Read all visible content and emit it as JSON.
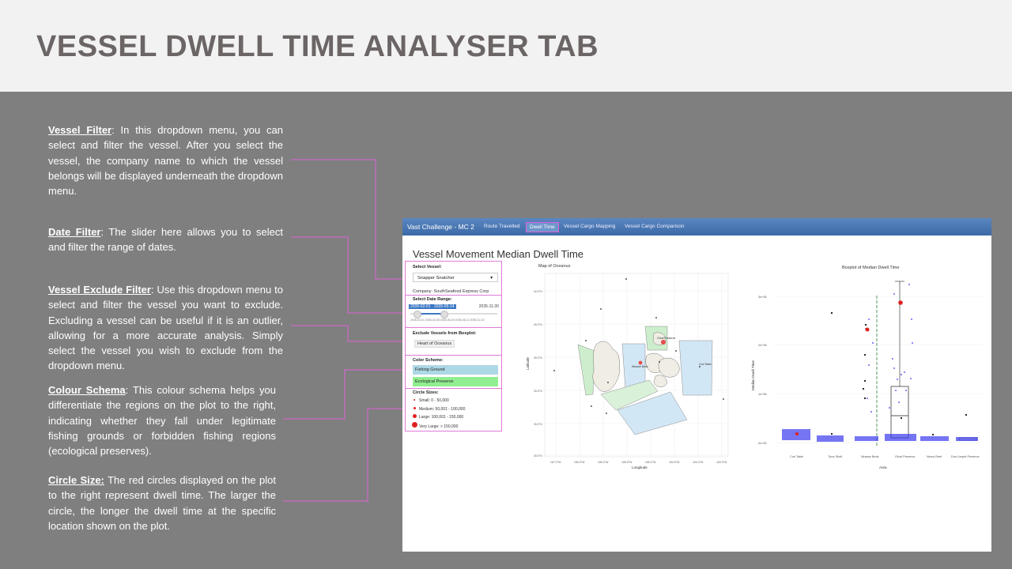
{
  "slide": {
    "title": "VESSEL DWELL TIME ANALYSER TAB"
  },
  "notes": [
    {
      "head": "Vessel Filter",
      "text": ": In this dropdown menu, you can select and filter the vessel. After you select the vessel, the company name to which the vessel belongs will be displayed underneath the dropdown menu."
    },
    {
      "head": "Date Filter",
      "text": ": The slider here allows you to select and filter the range of dates."
    },
    {
      "head": "Vessel Exclude Filter",
      "text": ": Use this dropdown menu to select and filter the vessel you want to exclude. Excluding a vessel can be useful if it is an outlier, allowing for a more accurate analysis. Simply select the vessel you wish to exclude from the dropdown menu."
    },
    {
      "head": "Colour Schema",
      "text": ": This colour schema helps you differentiate the regions on the plot to the right, indicating whether they fall under legitimate fishing grounds or forbidden fishing regions (ecological preserves)."
    },
    {
      "head": "Circle Size:",
      "text": " The red circles displayed on the plot to the right represent dwell time. The larger the circle, the longer the dwell time at the specific location shown on the plot."
    }
  ],
  "app": {
    "brand": "Vast Challenge - MC 2",
    "tabs": [
      "Route Travelled",
      "Dwell Time",
      "Vessel Cargo Mapping",
      "Vessel Cargo Comparison"
    ],
    "active_tab": "Dwell Time",
    "title": "Vessel Movement Median Dwell Time",
    "vessel": {
      "label": "Select Vessel:",
      "value": "Snapper Snatcher",
      "company": "Company: SouthSeafood Express Corp"
    },
    "date": {
      "label": "Select Date Range:",
      "start": "2035-02-01",
      "end": "2035-05-14",
      "max": "2035-11-30",
      "ticks": [
        "2035-02-01",
        "2035-04-08",
        "2035-06-09",
        "2035-08-12",
        "2035-10-15"
      ]
    },
    "exclude": {
      "label": "Exclude Vessels from Boxplot:",
      "value": "Heart of Oceanus"
    },
    "scheme": {
      "label": "Color Scheme:",
      "items": [
        "Fishing Ground",
        "Ecological Preserve"
      ],
      "colors": [
        "#add8e6",
        "#90ee90"
      ]
    },
    "circles": {
      "label": "Circle Sizes:",
      "items": [
        "Small: 0 - 50,000",
        "Medium: 50,001 - 100,000",
        "Large: 100,001 - 150,000",
        "Very Large: > 150,000"
      ]
    },
    "map": {
      "title": "Map of Oceanus",
      "xlabel": "Longitude",
      "ylabel": "Latitude",
      "yticks": [
        "40.0°N",
        "35.5°N",
        "35.0°N",
        "35.5°N",
        "35.0°N",
        "35.5°N"
      ],
      "xticks": [
        "167.0°W",
        "166.5°W",
        "166.0°W",
        "165.5°W",
        "165.0°W",
        "164.5°W",
        "164.0°W",
        "163.5°W"
      ],
      "labels": [
        "Ghoti Preserve",
        "Wrasse Beds",
        "Cod Table"
      ]
    },
    "boxplot": {
      "title": "Boxplot of Median Dwell Time",
      "xlabel": "Area",
      "ylabel": "Median Dwell Time",
      "yticks": [
        "3e+05",
        "2e+05",
        "1e+05",
        "0e+00"
      ],
      "categories": [
        "Cod Table",
        "Tuna Shelf",
        "Wrasse Beds",
        "Ghoti Preserve",
        "Nemo Reef",
        "Don Limpet Preserve"
      ]
    }
  }
}
